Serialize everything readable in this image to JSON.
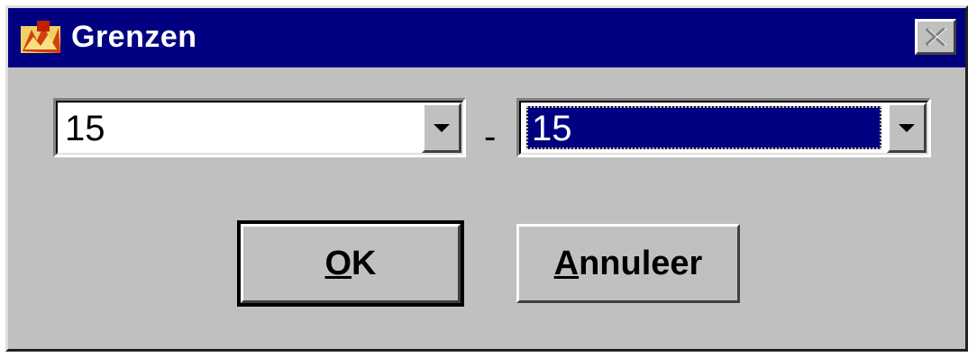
{
  "window": {
    "title": "Grenzen",
    "app_icon": "app-logo-icon",
    "close_icon": "close-icon"
  },
  "range": {
    "from_value": "15",
    "separator": "-",
    "to_value": "15"
  },
  "buttons": {
    "ok_mnemonic": "O",
    "ok_rest": "K",
    "cancel_mnemonic": "A",
    "cancel_rest": "nnuleer"
  },
  "colors": {
    "titlebar": "#000080",
    "face": "#c0c0c0",
    "selection": "#000080"
  }
}
